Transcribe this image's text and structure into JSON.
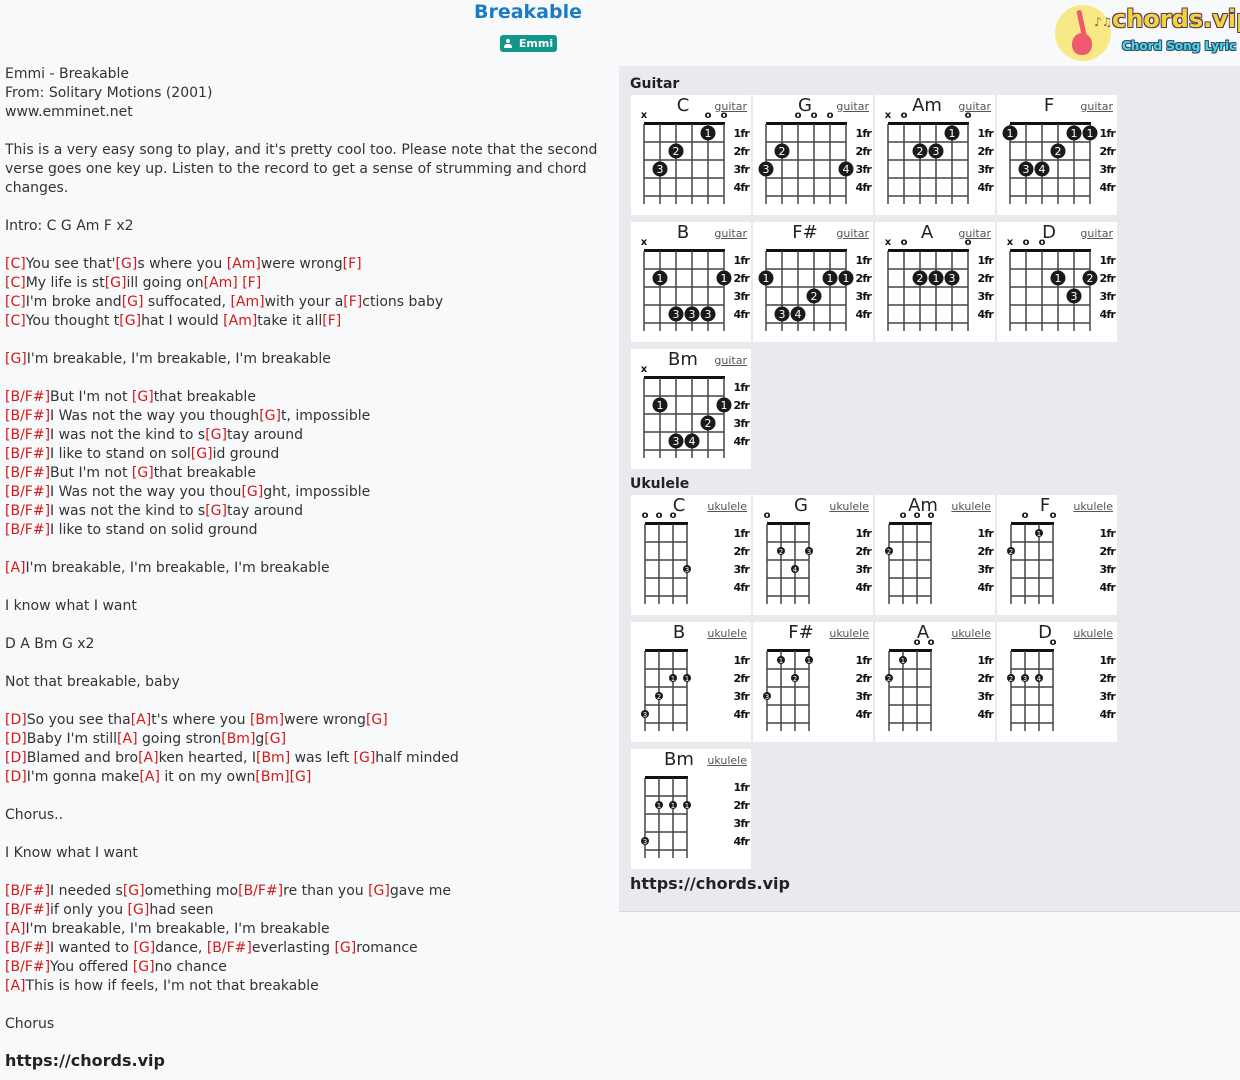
{
  "header": {
    "title": "Breakable",
    "artist": "Emmi",
    "artist_icon": "person-icon",
    "logo": {
      "brand": "chords.vip",
      "tagline": "Chord Song Lyric",
      "icon": "guitar-icon"
    }
  },
  "lyrics": [
    [
      [
        "t",
        "Emmi - Breakable"
      ]
    ],
    [
      [
        "t",
        "From: Solitary Motions (2001)"
      ]
    ],
    [
      [
        "t",
        "www.emminet.net"
      ]
    ],
    [],
    [
      [
        "t",
        "This is a very easy song to play, and it's pretty cool too. Please note that the second"
      ]
    ],
    [
      [
        "t",
        "verse goes one key up. Listen to the record to get a sense of strumming and chord"
      ]
    ],
    [
      [
        "t",
        "changes."
      ]
    ],
    [],
    [
      [
        "t",
        "Intro: C G Am F x2"
      ]
    ],
    [],
    [
      [
        "c",
        "[C]"
      ],
      [
        "t",
        "You see that'"
      ],
      [
        "c",
        "[G]"
      ],
      [
        "t",
        "s where you "
      ],
      [
        "c",
        "[Am]"
      ],
      [
        "t",
        "were wrong"
      ],
      [
        "c",
        "[F]"
      ]
    ],
    [
      [
        "c",
        "[C]"
      ],
      [
        "t",
        "My life is st"
      ],
      [
        "c",
        "[G]"
      ],
      [
        "t",
        "ill going on"
      ],
      [
        "c",
        "[Am]"
      ],
      [
        "t",
        " "
      ],
      [
        "c",
        "[F]"
      ]
    ],
    [
      [
        "c",
        "[C]"
      ],
      [
        "t",
        "I'm broke and"
      ],
      [
        "c",
        "[G]"
      ],
      [
        "t",
        " suffocated, "
      ],
      [
        "c",
        "[Am]"
      ],
      [
        "t",
        "with your a"
      ],
      [
        "c",
        "[F]"
      ],
      [
        "t",
        "ctions baby"
      ]
    ],
    [
      [
        "c",
        "[C]"
      ],
      [
        "t",
        "You thought t"
      ],
      [
        "c",
        "[G]"
      ],
      [
        "t",
        "hat I would "
      ],
      [
        "c",
        "[Am]"
      ],
      [
        "t",
        "take it all"
      ],
      [
        "c",
        "[F]"
      ]
    ],
    [],
    [
      [
        "c",
        "[G]"
      ],
      [
        "t",
        "I'm breakable, I'm breakable, I'm breakable"
      ]
    ],
    [],
    [
      [
        "c",
        "[B/F#]"
      ],
      [
        "t",
        "But I'm not "
      ],
      [
        "c",
        "[G]"
      ],
      [
        "t",
        "that breakable"
      ]
    ],
    [
      [
        "c",
        "[B/F#]"
      ],
      [
        "t",
        "I Was not the way you though"
      ],
      [
        "c",
        "[G]"
      ],
      [
        "t",
        "t, impossible"
      ]
    ],
    [
      [
        "c",
        "[B/F#]"
      ],
      [
        "t",
        "I was not the kind to s"
      ],
      [
        "c",
        "[G]"
      ],
      [
        "t",
        "tay around"
      ]
    ],
    [
      [
        "c",
        "[B/F#]"
      ],
      [
        "t",
        "I like to stand on sol"
      ],
      [
        "c",
        "[G]"
      ],
      [
        "t",
        "id ground"
      ]
    ],
    [
      [
        "c",
        "[B/F#]"
      ],
      [
        "t",
        "But I'm not "
      ],
      [
        "c",
        "[G]"
      ],
      [
        "t",
        "that breakable"
      ]
    ],
    [
      [
        "c",
        "[B/F#]"
      ],
      [
        "t",
        "I Was not the way you thou"
      ],
      [
        "c",
        "[G]"
      ],
      [
        "t",
        "ght, impossible"
      ]
    ],
    [
      [
        "c",
        "[B/F#]"
      ],
      [
        "t",
        "I was not the kind to s"
      ],
      [
        "c",
        "[G]"
      ],
      [
        "t",
        "tay around"
      ]
    ],
    [
      [
        "c",
        "[B/F#]"
      ],
      [
        "t",
        "I like to stand on solid ground"
      ]
    ],
    [],
    [
      [
        "c",
        "[A]"
      ],
      [
        "t",
        "I'm breakable, I'm breakable, I'm breakable"
      ]
    ],
    [],
    [
      [
        "t",
        "I know what I want"
      ]
    ],
    [],
    [
      [
        "t",
        "D A Bm G x2"
      ]
    ],
    [],
    [
      [
        "t",
        "Not that breakable, baby"
      ]
    ],
    [],
    [
      [
        "c",
        "[D]"
      ],
      [
        "t",
        "So you see tha"
      ],
      [
        "c",
        "[A]"
      ],
      [
        "t",
        "t's where you "
      ],
      [
        "c",
        "[Bm]"
      ],
      [
        "t",
        "were wrong"
      ],
      [
        "c",
        "[G]"
      ]
    ],
    [
      [
        "c",
        "[D]"
      ],
      [
        "t",
        "Baby I'm still"
      ],
      [
        "c",
        "[A]"
      ],
      [
        "t",
        " going stron"
      ],
      [
        "c",
        "[Bm]"
      ],
      [
        "t",
        "g"
      ],
      [
        "c",
        "[G]"
      ]
    ],
    [
      [
        "c",
        "[D]"
      ],
      [
        "t",
        "Blamed and bro"
      ],
      [
        "c",
        "[A]"
      ],
      [
        "t",
        "ken hearted, I"
      ],
      [
        "c",
        "[Bm]"
      ],
      [
        "t",
        " was left "
      ],
      [
        "c",
        "[G]"
      ],
      [
        "t",
        "half minded"
      ]
    ],
    [
      [
        "c",
        "[D]"
      ],
      [
        "t",
        "I'm gonna make"
      ],
      [
        "c",
        "[A]"
      ],
      [
        "t",
        " it on my own"
      ],
      [
        "c",
        "[Bm]"
      ],
      [
        "c",
        "[G]"
      ]
    ],
    [],
    [
      [
        "t",
        "Chorus.."
      ]
    ],
    [],
    [
      [
        "t",
        "I Know what I want"
      ]
    ],
    [],
    [
      [
        "c",
        "[B/F#]"
      ],
      [
        "t",
        "I needed s"
      ],
      [
        "c",
        "[G]"
      ],
      [
        "t",
        "omething mo"
      ],
      [
        "c",
        "[B/F#]"
      ],
      [
        "t",
        "re than you "
      ],
      [
        "c",
        "[G]"
      ],
      [
        "t",
        "gave me"
      ]
    ],
    [
      [
        "c",
        "[B/F#]"
      ],
      [
        "t",
        "if only you "
      ],
      [
        "c",
        "[G]"
      ],
      [
        "t",
        "had seen"
      ]
    ],
    [
      [
        "c",
        "[A]"
      ],
      [
        "t",
        "I'm breakable, I'm breakable, I'm breakable"
      ]
    ],
    [
      [
        "c",
        "[B/F#]"
      ],
      [
        "t",
        "I wanted to "
      ],
      [
        "c",
        "[G]"
      ],
      [
        "t",
        "dance, "
      ],
      [
        "c",
        "[B/F#]"
      ],
      [
        "t",
        "everlasting "
      ],
      [
        "c",
        "[G]"
      ],
      [
        "t",
        "romance"
      ]
    ],
    [
      [
        "c",
        "[B/F#]"
      ],
      [
        "t",
        "You offered "
      ],
      [
        "c",
        "[G]"
      ],
      [
        "t",
        "no chance"
      ]
    ],
    [
      [
        "c",
        "[A]"
      ],
      [
        "t",
        "This is how if feels, I'm not that breakable"
      ]
    ],
    [],
    [
      [
        "t",
        "Chorus"
      ]
    ]
  ],
  "footer_url": "https://chords.vip",
  "panel": {
    "guitar_label": "Guitar",
    "ukulele_label": "Ukulele",
    "url": "https://chords.vip",
    "fret_labels": [
      "1fr",
      "2fr",
      "3fr",
      "4fr"
    ],
    "colors": {
      "dot": "#1a1a1a",
      "chord": "#d11a1a",
      "title": "#1a7dc4",
      "badge": "#12968a"
    },
    "guitar": [
      {
        "name": "C",
        "type": "guitar",
        "markers": [
          "x",
          "",
          "",
          "",
          "o",
          "o"
        ],
        "dots": [
          [
            5,
            1,
            "1"
          ],
          [
            3,
            2,
            "2"
          ],
          [
            2,
            3,
            "3"
          ]
        ]
      },
      {
        "name": "G",
        "type": "guitar",
        "markers": [
          "",
          "",
          "o",
          "o",
          "o",
          ""
        ],
        "dots": [
          [
            2,
            2,
            "2"
          ],
          [
            1,
            3,
            "3"
          ],
          [
            6,
            3,
            "4"
          ]
        ]
      },
      {
        "name": "Am",
        "type": "guitar",
        "markers": [
          "x",
          "o",
          "",
          "",
          "",
          "o"
        ],
        "dots": [
          [
            5,
            1,
            "1"
          ],
          [
            3,
            2,
            "2"
          ],
          [
            4,
            2,
            "3"
          ]
        ]
      },
      {
        "name": "F",
        "type": "guitar",
        "markers": [
          "",
          "",
          "",
          "",
          "",
          ""
        ],
        "dots": [
          [
            1,
            1,
            "1"
          ],
          [
            5,
            1,
            "1"
          ],
          [
            6,
            1,
            "1"
          ],
          [
            4,
            2,
            "2"
          ],
          [
            2,
            3,
            "3"
          ],
          [
            3,
            3,
            "4"
          ]
        ]
      },
      {
        "name": "B",
        "type": "guitar",
        "markers": [
          "x",
          "",
          "",
          "",
          "",
          ""
        ],
        "dots": [
          [
            2,
            2,
            "1"
          ],
          [
            6,
            2,
            "1"
          ],
          [
            3,
            4,
            "3"
          ],
          [
            4,
            4,
            "3"
          ],
          [
            5,
            4,
            "3"
          ]
        ]
      },
      {
        "name": "F#",
        "type": "guitar",
        "markers": [
          "",
          "",
          "",
          "",
          "",
          ""
        ],
        "dots": [
          [
            1,
            2,
            "1"
          ],
          [
            5,
            2,
            "1"
          ],
          [
            6,
            2,
            "1"
          ],
          [
            4,
            3,
            "2"
          ],
          [
            2,
            4,
            "3"
          ],
          [
            3,
            4,
            "4"
          ]
        ]
      },
      {
        "name": "A",
        "type": "guitar",
        "markers": [
          "x",
          "o",
          "",
          "",
          "",
          "o"
        ],
        "dots": [
          [
            3,
            2,
            "2"
          ],
          [
            4,
            2,
            "1"
          ],
          [
            5,
            2,
            "3"
          ]
        ]
      },
      {
        "name": "D",
        "type": "guitar",
        "markers": [
          "x",
          "o",
          "o",
          "",
          "",
          ""
        ],
        "dots": [
          [
            4,
            2,
            "1"
          ],
          [
            6,
            2,
            "2"
          ],
          [
            5,
            3,
            "3"
          ]
        ]
      },
      {
        "name": "Bm",
        "type": "guitar",
        "markers": [
          "x",
          "",
          "",
          "",
          "",
          ""
        ],
        "dots": [
          [
            2,
            2,
            "1"
          ],
          [
            6,
            2,
            "1"
          ],
          [
            5,
            3,
            "2"
          ],
          [
            3,
            4,
            "3"
          ],
          [
            4,
            4,
            "4"
          ]
        ]
      }
    ],
    "ukulele": [
      {
        "name": "C",
        "type": "ukulele",
        "markers": [
          "o",
          "o",
          "o",
          ""
        ],
        "dots": [
          [
            4,
            3,
            "3"
          ]
        ]
      },
      {
        "name": "G",
        "type": "ukulele",
        "markers": [
          "o",
          "",
          "",
          ""
        ],
        "dots": [
          [
            2,
            2,
            "2"
          ],
          [
            4,
            2,
            "3"
          ],
          [
            3,
            3,
            "4"
          ]
        ]
      },
      {
        "name": "Am",
        "type": "ukulele",
        "markers": [
          "",
          "o",
          "o",
          "o"
        ],
        "dots": [
          [
            1,
            2,
            "2"
          ]
        ]
      },
      {
        "name": "F",
        "type": "ukulele",
        "markers": [
          "",
          "o",
          "",
          "o"
        ],
        "dots": [
          [
            3,
            1,
            "1"
          ],
          [
            1,
            2,
            "2"
          ]
        ]
      },
      {
        "name": "B",
        "type": "ukulele",
        "markers": [
          "",
          "",
          "",
          ""
        ],
        "dots": [
          [
            3,
            2,
            "1"
          ],
          [
            4,
            2,
            "1"
          ],
          [
            2,
            3,
            "2"
          ],
          [
            1,
            4,
            "3"
          ]
        ]
      },
      {
        "name": "F#",
        "type": "ukulele",
        "markers": [
          "",
          "",
          "",
          ""
        ],
        "dots": [
          [
            2,
            1,
            "1"
          ],
          [
            4,
            1,
            "1"
          ],
          [
            3,
            2,
            "2"
          ],
          [
            1,
            3,
            "3"
          ]
        ]
      },
      {
        "name": "A",
        "type": "ukulele",
        "markers": [
          "",
          "",
          "o",
          "o"
        ],
        "dots": [
          [
            2,
            1,
            "1"
          ],
          [
            1,
            2,
            "2"
          ]
        ]
      },
      {
        "name": "D",
        "type": "ukulele",
        "markers": [
          "",
          "",
          "",
          "o"
        ],
        "dots": [
          [
            1,
            2,
            "2"
          ],
          [
            2,
            2,
            "3"
          ],
          [
            3,
            2,
            "4"
          ]
        ]
      },
      {
        "name": "Bm",
        "type": "ukulele",
        "markers": [
          "",
          "",
          "",
          ""
        ],
        "dots": [
          [
            2,
            2,
            "1"
          ],
          [
            3,
            2,
            "1"
          ],
          [
            4,
            2,
            "1"
          ],
          [
            1,
            4,
            "3"
          ]
        ]
      }
    ]
  }
}
